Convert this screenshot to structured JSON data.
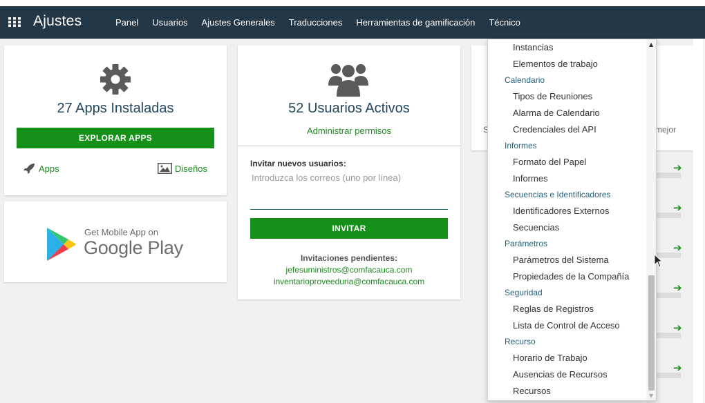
{
  "navbar": {
    "brand": "Ajustes",
    "menu": [
      "Panel",
      "Usuarios",
      "Ajustes Generales",
      "Traducciones",
      "Herramientas de gamificación",
      "Técnico"
    ]
  },
  "apps_card": {
    "title": "27 Apps Instaladas",
    "button": "EXPLORAR APPS",
    "link_apps": "Apps",
    "link_designs": "Diseños"
  },
  "play_card": {
    "subtitle": "Get Mobile App on",
    "store": "Google Play"
  },
  "users_card": {
    "title": "52 Usuarios Activos",
    "manage_link": "Administrar permisos",
    "invite_label": "Invitar nuevos usuarios:",
    "invite_placeholder": "Introduzca los correos (uno por línea)",
    "invite_button": "INVITAR",
    "pending_title": "Invitaciones pendientes:",
    "pending_emails": [
      "jefesuministros@comfacauca.com",
      "inventarioproveeduria@comfacauca.com"
    ]
  },
  "right_card": {
    "partial_left": "S",
    "partial_right": "o mejor"
  },
  "dropdown": {
    "groups": [
      {
        "header": "",
        "items": [
          "Instancias",
          "Elementos de trabajo"
        ]
      },
      {
        "header": "Calendario",
        "items": [
          "Tipos de Reuniones",
          "Alarma de Calendario",
          "Credenciales del API"
        ]
      },
      {
        "header": "Informes",
        "items": [
          "Formato del Papel",
          "Informes"
        ]
      },
      {
        "header": "Secuencias e Identificadores",
        "items": [
          "Identificadores Externos",
          "Secuencias"
        ]
      },
      {
        "header": "Parámetros",
        "items": [
          "Parámetros del Sistema",
          "Propiedades de la Compañía"
        ]
      },
      {
        "header": "Seguridad",
        "items": [
          "Reglas de Registros",
          "Lista de Control de Acceso"
        ]
      },
      {
        "header": "Recurso",
        "items": [
          "Horario de Trabajo",
          "Ausencias de Recursos",
          "Recursos"
        ]
      }
    ]
  },
  "colors": {
    "navbar": "#233746",
    "accent_green": "#159018",
    "title_blue": "#23475e"
  }
}
